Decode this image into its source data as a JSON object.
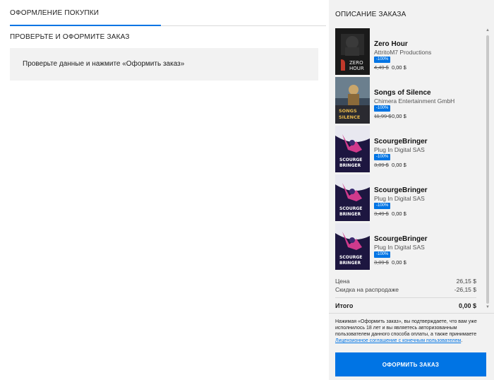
{
  "checkout": {
    "tab_label": "ОФОРМЛЕНИЕ ПОКУПКИ",
    "review_heading": "ПРОВЕРЬТЕ И ОФОРМИТЕ ЗАКАЗ",
    "review_text": "Проверьте данные и нажмите «Оформить заказ»"
  },
  "summary": {
    "title": "ОПИСАНИЕ ЗАКАЗА",
    "items": [
      {
        "title": "Zero Hour",
        "developer": "AttritoM7 Productions",
        "discount": "-100%",
        "old_price": "4,49 $",
        "new_price": "0,00 $",
        "thumb_icon": "zero-hour-cover"
      },
      {
        "title": "Songs of Silence",
        "developer": "Chimera Entertainment GmbH",
        "discount": "-100%",
        "old_price": "11,99 $",
        "new_price": "0,00 $",
        "thumb_icon": "songs-of-silence-cover"
      },
      {
        "title": "ScourgeBringer",
        "developer": "Plug In Digital SAS",
        "discount": "-100%",
        "old_price": "3,09 $",
        "new_price": "0,00 $",
        "thumb_icon": "scourgebringer-cover"
      },
      {
        "title": "ScourgeBringer",
        "developer": "Plug In Digital SAS",
        "discount": "-100%",
        "old_price": "3,49 $",
        "new_price": "0,00 $",
        "thumb_icon": "scourgebringer-cover"
      },
      {
        "title": "ScourgeBringer",
        "developer": "Plug In Digital SAS",
        "discount": "-100%",
        "old_price": "3,09 $",
        "new_price": "0,00 $",
        "thumb_icon": "scourgebringer-cover"
      }
    ],
    "price_label": "Цена",
    "price_value": "26,15 $",
    "sale_label": "Скидка на распродаже",
    "sale_value": "-26,15 $",
    "total_label": "Итого",
    "total_value": "0,00 $"
  },
  "legal": {
    "text_before": "Нажимая «Оформить заказ», вы подтверждаете, что вам уже исполнилось 18 лет и вы являетесь авторизованным пользователем данного способа оплаты, а также принимаете ",
    "link": "Лицензионное соглашение с конечным пользователем",
    "text_after": "."
  },
  "order_button": "ОФОРМИТЬ ЗАКАЗ",
  "colors": {
    "accent": "#0074e4",
    "panel": "#f2f2f2"
  }
}
